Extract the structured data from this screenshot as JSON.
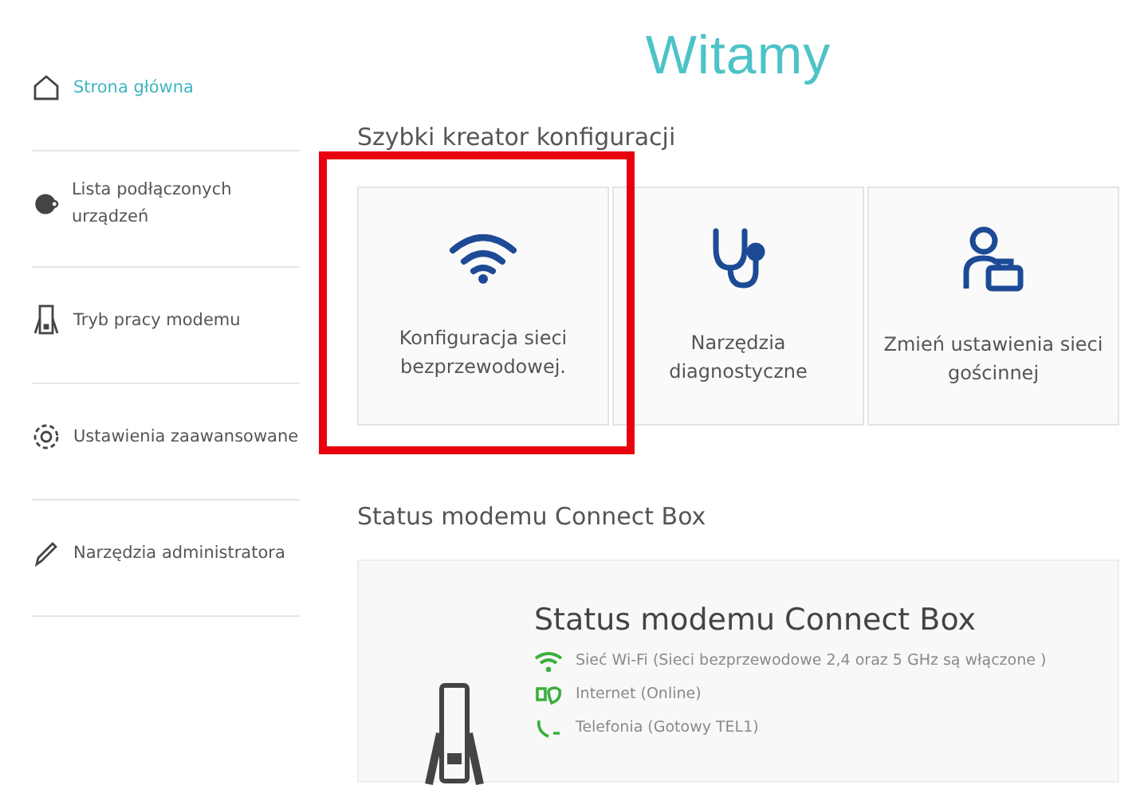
{
  "sidebar": {
    "items": [
      {
        "label": "Strona główna",
        "selected": true
      },
      {
        "label": "Lista podłączonych urządzeń",
        "selected": false
      },
      {
        "label": "Tryb pracy modemu",
        "selected": false
      },
      {
        "label": "Ustawienia zaawansowane",
        "selected": false
      },
      {
        "label": "Narzędzia administratora",
        "selected": false
      }
    ]
  },
  "title": "Witamy",
  "wizard": {
    "heading": "Szybki kreator konfiguracji",
    "tiles": [
      {
        "label": "Konfiguracja sieci bezprzewodowej.",
        "highlighted": true
      },
      {
        "label": "Narzędzia diagnostyczne",
        "highlighted": false
      },
      {
        "label": "Zmień ustawienia sieci gościnnej",
        "highlighted": false
      }
    ]
  },
  "status": {
    "heading": "Status modemu Connect Box",
    "card_title": "Status modemu Connect Box",
    "lines": [
      {
        "text": "Sieć Wi-Fi (Sieci bezprzewodowe 2,4 oraz 5 GHz są włączone )"
      },
      {
        "text": "Internet (Online)"
      },
      {
        "text": "Telefonia (Gotowy TEL1)"
      }
    ]
  }
}
